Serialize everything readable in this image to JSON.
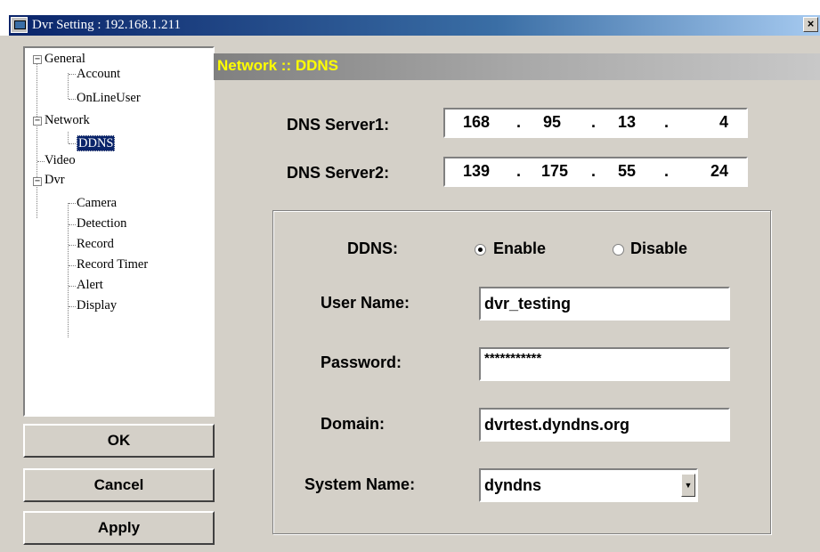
{
  "window": {
    "title": "Dvr Setting : 192.168.1.211",
    "close_label": "×"
  },
  "tree": {
    "general": "General",
    "account": "Account",
    "online_user": "OnLineUser",
    "network": "Network",
    "ddns": "DDNS",
    "video": "Video",
    "dvr": "Dvr",
    "camera": "Camera",
    "detection": "Detection",
    "record": "Record",
    "record_timer": "Record Timer",
    "alert": "Alert",
    "display": "Display",
    "expander_minus": "−"
  },
  "buttons": {
    "ok": "OK",
    "cancel": "Cancel",
    "apply": "Apply"
  },
  "panel": {
    "title": "Network :: DDNS"
  },
  "dns": {
    "server1_label": "DNS Server1:",
    "server1": [
      "168",
      "95",
      "13",
      "4"
    ],
    "server2_label": "DNS Server2:",
    "server2": [
      "139",
      "175",
      "55",
      "24"
    ],
    "separator": "."
  },
  "ddns": {
    "label": "DDNS:",
    "enable_label": "Enable",
    "disable_label": "Disable",
    "selected": "Enable",
    "username_label": "User Name:",
    "username": "dvr_testing",
    "password_label": "Password:",
    "password": "***********",
    "domain_label": "Domain:",
    "domain": "dvrtest.dyndns.org",
    "system_name_label": "System Name:",
    "system_name": "dyndns",
    "dropdown_glyph": "▼"
  }
}
